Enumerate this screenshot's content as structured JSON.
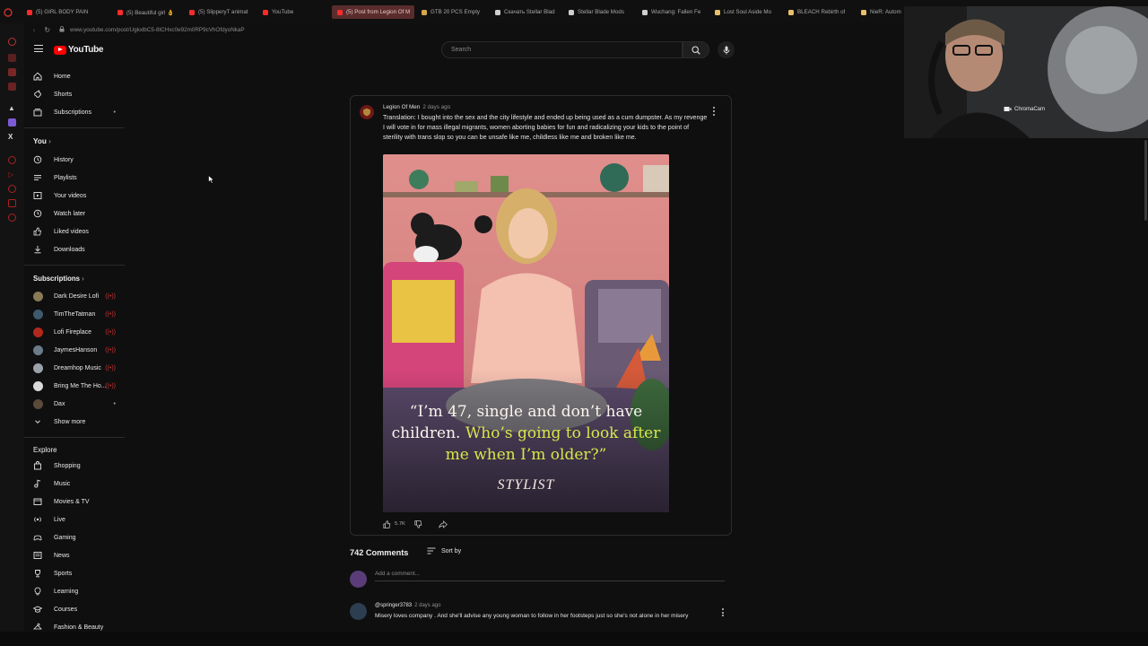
{
  "browser": {
    "tabs": [
      {
        "label": "(5) GIRL BODY PAIN",
        "color": "#ff2b2b"
      },
      {
        "label": "(5) Beautiful girl 👌",
        "color": "#ff2b2b"
      },
      {
        "label": "(5) SlipperyT animat",
        "color": "#ff2b2b"
      },
      {
        "label": "YouTube",
        "color": "#ff2b2b"
      },
      {
        "label": "(5) Post from Legion Of M",
        "color": "#ff2b2b",
        "active": true
      },
      {
        "label": "GTB 20 PCS Empty",
        "color": "#d7a64a"
      },
      {
        "label": "Скачать Stellar Blad",
        "color": "#cfcfcf"
      },
      {
        "label": "Stellar Blade Mods",
        "color": "#cfcfcf"
      },
      {
        "label": "Wuchang: Fallen Fe",
        "color": "#cfcfcf"
      },
      {
        "label": "Lost Soul Aside Mo",
        "color": "#e8c06a"
      },
      {
        "label": "BLEACH Rebirth of",
        "color": "#e8c06a"
      },
      {
        "label": "NieR: Autom",
        "color": "#e8c06a"
      }
    ],
    "url": "www.youtube.com/post/UgkxlbC5-8tCHxc0e92m0RP9cVhOfdyoNkaP"
  },
  "header": {
    "logo_text": "YouTube",
    "search_placeholder": "Search"
  },
  "sidebar": {
    "main": [
      "Home",
      "Shorts",
      "Subscriptions"
    ],
    "you_label": "You",
    "you_items": [
      "History",
      "Playlists",
      "Your videos",
      "Watch later",
      "Liked videos",
      "Downloads"
    ],
    "subscriptions_label": "Subscriptions",
    "subscriptions": [
      {
        "name": "Dark Desire Lofi",
        "color": "#8a7a55"
      },
      {
        "name": "TimTheTatman",
        "color": "#3d5a6e"
      },
      {
        "name": "Lofi Fireplace",
        "color": "#b3281c"
      },
      {
        "name": "JaymesHanson",
        "color": "#6a7b8a"
      },
      {
        "name": "Dreamhop Music",
        "color": "#9aa1a8"
      },
      {
        "name": "Bring Me The Ho...",
        "color": "#d9d9d9"
      },
      {
        "name": "Dax",
        "color": "#5a4a3a"
      }
    ],
    "show_more": "Show more",
    "explore_label": "Explore",
    "explore": [
      "Shopping",
      "Music",
      "Movies & TV",
      "Live",
      "Gaming",
      "News",
      "Sports",
      "Learning",
      "Courses",
      "Fashion & Beauty"
    ]
  },
  "post": {
    "author": "Legion Of Men",
    "time": "2 days ago",
    "text": "Translation: I bought into the sex and the city lifestyle and ended up being used as a cum dumpster. As my revenge I will vote in for mass illegal migrants, women aborting babies for fun and radicalizing your kids to the point of sterility with trans slop so you can be unsafe like me, childless like me and broken like me.",
    "image_quote_plain": "“I’m 47, single and don’t have children.",
    "image_quote_highlight": "Who’s going to look after me when I’m older?”",
    "image_brand": "STYLIST",
    "likes": "5.7K"
  },
  "comments": {
    "count_label": "742 Comments",
    "sort_label": "Sort by",
    "add_placeholder": "Add a comment...",
    "first": {
      "author": "@springer3783",
      "time": "2 days ago",
      "text": "Misery loves company . And she'll advise any young woman to follow in her footsteps just so she's not alone in her misery"
    }
  },
  "webcam": {
    "label": "ChromaCam"
  }
}
